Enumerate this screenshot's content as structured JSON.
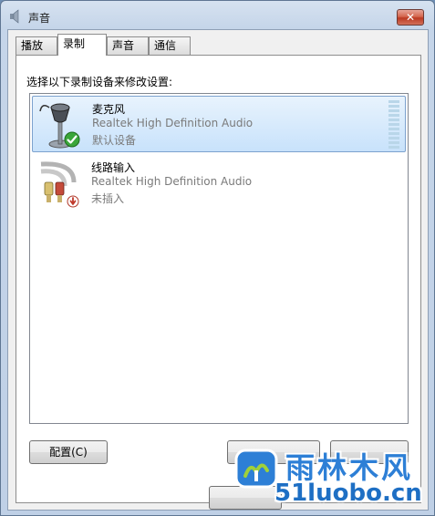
{
  "window": {
    "title": "声音",
    "close_label": "✕"
  },
  "tabs": [
    {
      "label": "播放",
      "active": false
    },
    {
      "label": "录制",
      "active": true
    },
    {
      "label": "声音",
      "active": false
    },
    {
      "label": "通信",
      "active": false
    }
  ],
  "instruction": "选择以下录制设备来修改设置:",
  "devices": [
    {
      "name": "麦克风",
      "driver": "Realtek High Definition Audio",
      "status": "默认设备",
      "icon": "microphone-icon",
      "badge": "default-check-icon",
      "selected": true
    },
    {
      "name": "线路输入",
      "driver": "Realtek High Definition Audio",
      "status": "未插入",
      "icon": "line-in-cable-icon",
      "badge": "unplugged-icon",
      "selected": false
    }
  ],
  "buttons": {
    "configure": "配置(C)"
  },
  "watermark": {
    "brand": "雨林木风",
    "url": "51luobo.cn"
  },
  "colors": {
    "selection": "#c8e2fb",
    "watermark": "#2d7fd6",
    "close": "#c7452d"
  }
}
